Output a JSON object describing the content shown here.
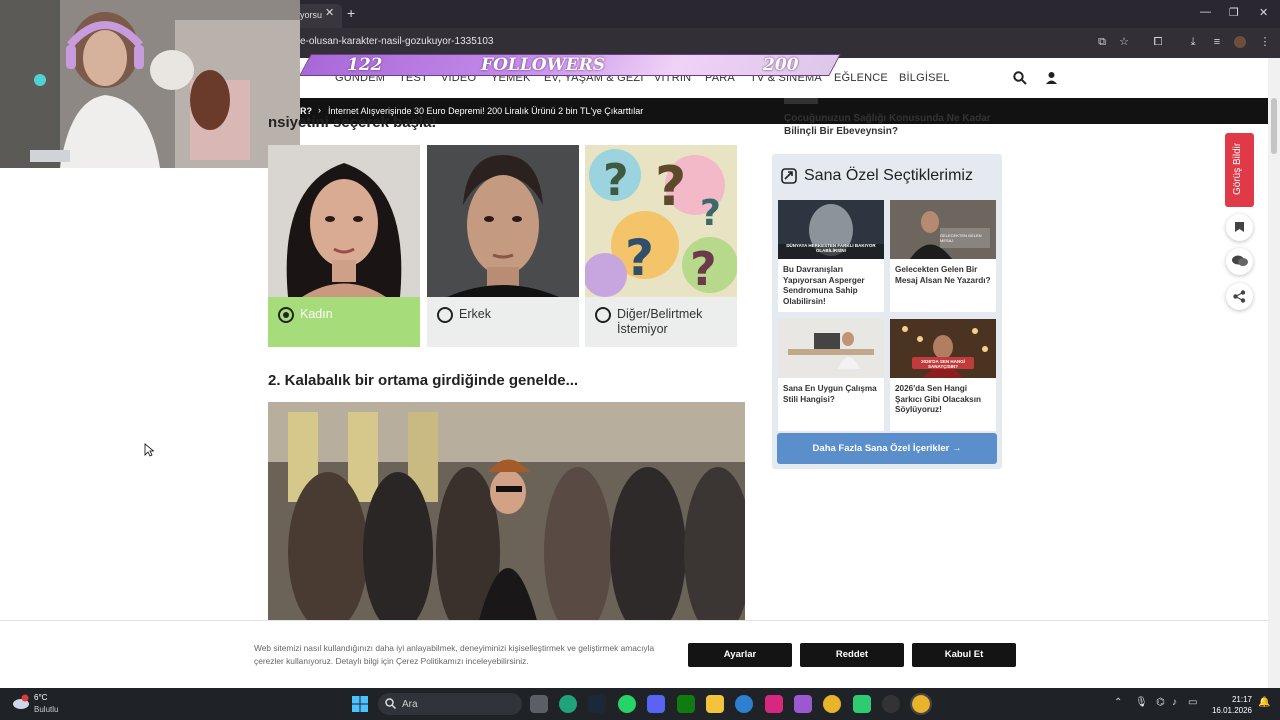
{
  "browser": {
    "tab_title": "yorsu",
    "url": "e-olusan-karakter-nasil-gozukuyor-1335103",
    "close_glyph": "✕",
    "newtab_glyph": "+"
  },
  "overlay": {
    "followers_count": "122",
    "followers_label": "FOLLOWERS",
    "followers_goal": "200"
  },
  "nav": {
    "items": [
      "GÜNDEM",
      "TEST",
      "VİDEO",
      "YEMEK",
      "EV, YAŞAM & GEZİ",
      "VİTRİN",
      "PARA",
      "TV & SİNEMA",
      "EĞLENCE",
      "BİLGİSEL"
    ]
  },
  "ticker": {
    "prefix": "R?",
    "headline": "İnternet Alışverişinde 30 Euro Depremi! 200 Liralık Ürünü 2 bin TL'ye Çıkarttılar"
  },
  "quiz": {
    "q1_title": "nsiyetini seçerek başla!",
    "options": [
      {
        "label": "Kadın",
        "selected": true
      },
      {
        "label": "Erkek",
        "selected": false
      },
      {
        "label": "Diğer/Belirtmek İstemiyor",
        "selected": false
      }
    ],
    "q2_title": "2. Kalabalık bir ortama girdiğinde genelde..."
  },
  "sidebar": {
    "prev_article": "Çocuğunuzun Sağlığı Konusunda Ne Kadar Bilinçli Bir Ebeveynsin?",
    "picks_title": "Sana Özel Seçtiklerimiz",
    "picks": [
      {
        "title": "Bu Davranışları Yapıyorsan Asperger Sendromuna Sahip Olabilirsin!",
        "thumb_caption": "DÜNYAYA HERKESTEN FARKLI BAKIYOR OLABİLİRSİN!"
      },
      {
        "title": "Gelecekten Gelen Bir Mesaj Alsan Ne Yazardı?",
        "thumb_caption": "GELECEKTEN GELEN MESAJ"
      },
      {
        "title": "Sana En Uygun Çalışma Stili Hangisi?",
        "thumb_caption": ""
      },
      {
        "title": "2026'da Sen Hangi Şarkıcı Gibi Olacaksın Söylüyoruz!",
        "thumb_caption": "2026'DA SEN HANGİ SANATÇISIN?"
      }
    ],
    "more_button": "Daha Fazla Sana Özel İçerikler  →"
  },
  "floating": {
    "feedback": "Görüş Bildir"
  },
  "cookie": {
    "text": "Web sitemizi nasıl kullandığınızı daha iyi anlayabilmek, deneyiminizi kişiselleştirmek ve geliştirmek amacıyla çerezler kullanıyoruz. Detaylı bilgi için Çerez Politikamızı inceleyebilirsiniz.",
    "settings": "Ayarlar",
    "reject": "Reddet",
    "accept": "Kabul Et"
  },
  "taskbar": {
    "weather_temp": "6°C",
    "weather_desc": "Bulutlu",
    "search_placeholder": "Ara",
    "time": "21:17",
    "date": "16.01.2026"
  },
  "colors": {
    "selected_option": "#a6dc79",
    "option_bg": "#eceeed",
    "picks_bg": "#e5eaf1",
    "more_button": "#5b8fcb",
    "feedback": "#e03a48",
    "cookie_button": "#141414"
  }
}
